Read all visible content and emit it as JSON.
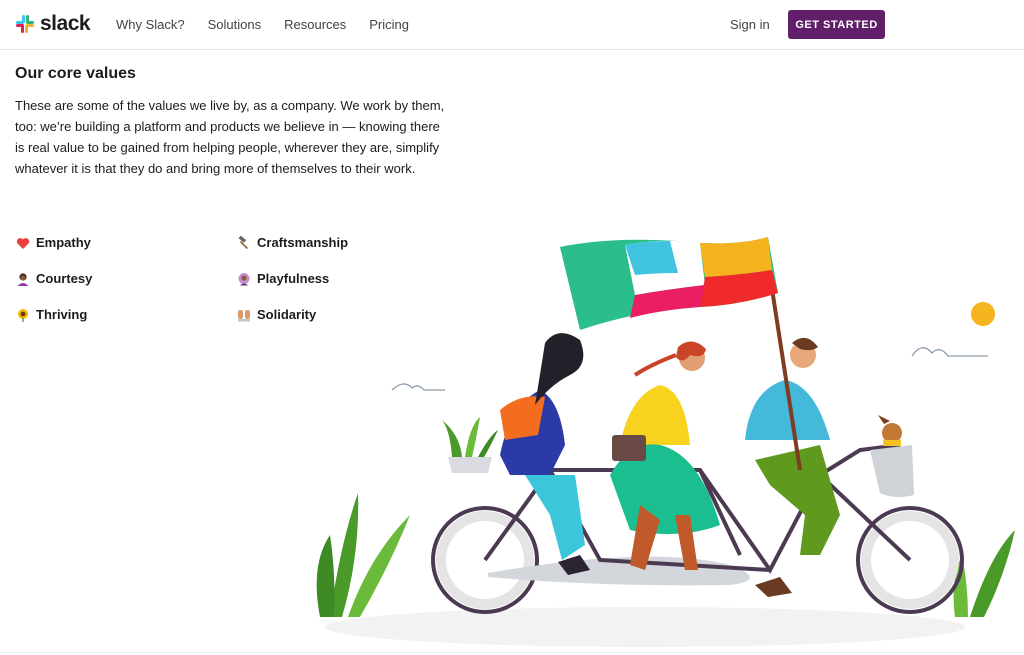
{
  "nav": {
    "logo_text": "slack",
    "links": [
      "Why Slack?",
      "Solutions",
      "Resources",
      "Pricing"
    ],
    "sign_in": "Sign in",
    "cta": "GET STARTED"
  },
  "content": {
    "heading": "Our core values",
    "intro": "These are some of the values we live by, as a company. We work by them, too: we’re building a platform and products we believe in — knowing there is real value to be gained from helping people, wherever they are, simplify whatever it is that they do and bring more of themselves to their work.",
    "values": [
      {
        "label": "Empathy",
        "icon": "heart-icon"
      },
      {
        "label": "Craftsmanship",
        "icon": "hammer-icon"
      },
      {
        "label": "Courtesy",
        "icon": "person-bowing-icon"
      },
      {
        "label": "Playfulness",
        "icon": "person-cartwheel-icon"
      },
      {
        "label": "Thriving",
        "icon": "sunflower-icon"
      },
      {
        "label": "Solidarity",
        "icon": "raised-hands-icon"
      }
    ]
  },
  "colors": {
    "brand_purple": "#611f69",
    "text_dark": "#1d1c1d"
  }
}
